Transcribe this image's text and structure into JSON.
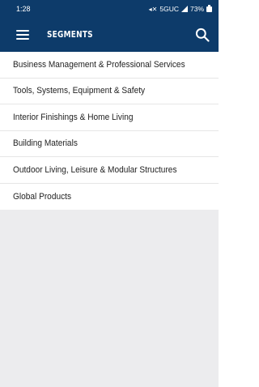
{
  "status_bar": {
    "time": "1:28",
    "network": "5GUC",
    "battery": "73%"
  },
  "app_bar": {
    "title": "SEGMENTS",
    "menu_icon": "hamburger-menu-icon",
    "search_icon": "search-icon"
  },
  "segments": {
    "items": [
      {
        "label": "Business Management & Professional Services"
      },
      {
        "label": "Tools, Systems, Equipment & Safety"
      },
      {
        "label": "Interior Finishings & Home Living"
      },
      {
        "label": "Building Materials"
      },
      {
        "label": "Outdoor Living, Leisure & Modular Structures"
      },
      {
        "label": "Global Products"
      }
    ]
  },
  "colors": {
    "header": "#0d3b6a",
    "background": "#ececee",
    "list_background": "#ffffff",
    "text": "#222222"
  }
}
